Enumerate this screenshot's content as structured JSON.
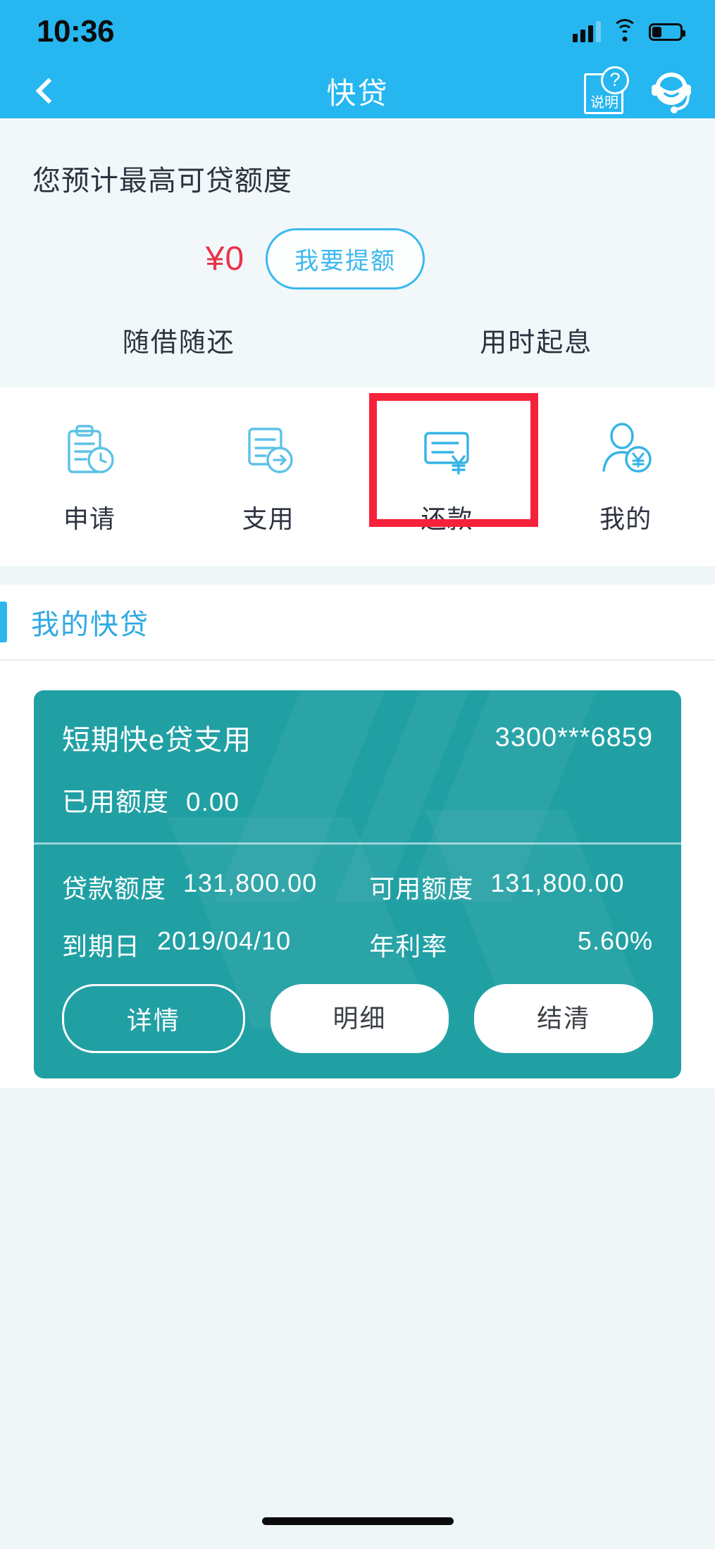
{
  "statusbar": {
    "time": "10:36",
    "signal_icon": "cellular-signal-icon",
    "wifi_icon": "wifi-icon",
    "battery_icon": "battery-icon"
  },
  "navbar": {
    "back_icon": "back-chevron-icon",
    "title": "快贷",
    "help_label": "说明",
    "help_badge": "?",
    "service_icon": "customer-service-icon"
  },
  "quota": {
    "title": "您预计最高可贷额度",
    "amount": "¥0",
    "raise_button": "我要提额",
    "features": [
      "随借随还",
      "用时起息"
    ]
  },
  "iconnav": {
    "items": [
      {
        "label": "申请",
        "icon": "application-clipboard-clock-icon",
        "highlighted": false
      },
      {
        "label": "支用",
        "icon": "disburse-document-arrow-icon",
        "highlighted": false
      },
      {
        "label": "还款",
        "icon": "repayment-note-yuan-icon",
        "highlighted": true
      },
      {
        "label": "我的",
        "icon": "profile-person-yuan-icon",
        "highlighted": false
      }
    ],
    "highlight_color": "#f6223c"
  },
  "my_loans": {
    "section_title": "我的快贷",
    "card": {
      "name": "短期快e贷支用",
      "account": "3300***6859",
      "used_label": "已用额度",
      "used_value": "0.00",
      "fields": [
        {
          "label": "贷款额度",
          "value": "131,800.00"
        },
        {
          "label": "可用额度",
          "value": "131,800.00"
        },
        {
          "label": "到期日",
          "value": "2019/04/10"
        },
        {
          "label": "年利率",
          "value": "5.60%"
        }
      ],
      "buttons": [
        "详情",
        "明细",
        "结清"
      ],
      "card_color": "#21a0a4"
    }
  },
  "theme": {
    "header_blue": "#26b6f0",
    "accent_blue": "#2fa9e4",
    "amount_red": "#e8344a",
    "page_bg": "#eef6f7"
  }
}
